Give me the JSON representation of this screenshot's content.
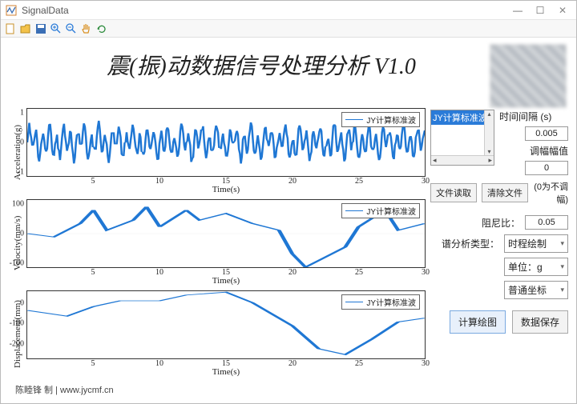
{
  "window": {
    "title": "SignalData"
  },
  "app": {
    "title": "震(振)动数据信号处理分析    V1.0"
  },
  "charts": {
    "xlabel": "Time(s)",
    "xticks": [
      "5",
      "10",
      "15",
      "20",
      "25",
      "30"
    ],
    "legend": "JY计算标准波",
    "accel": {
      "ylabel": "Acceleration(g)",
      "yticks": [
        "1",
        "0",
        "-1"
      ]
    },
    "vel": {
      "ylabel": "Velocity(mm/s)",
      "yticks": [
        "100",
        "0",
        "-100"
      ]
    },
    "disp": {
      "ylabel": "Displacement(mm)",
      "yticks": [
        "0",
        "-100",
        "-200"
      ]
    }
  },
  "side": {
    "list_selected": "JY计算标准波",
    "interval_label": "时间间隔 (s)",
    "interval_value": "0.005",
    "amp_label": "调幅幅值",
    "amp_value": "0",
    "amp_hint": "(0为不调幅)",
    "read_btn": "文件读取",
    "clear_btn": "清除文件",
    "damping_label": "阻尼比：",
    "damping_value": "0.05",
    "spectrum_label": "谱分析类型：",
    "spectrum_value": "时程绘制",
    "unit_label": "单位：g",
    "coord_value": "普通坐标",
    "plot_btn": "计算绘图",
    "save_btn": "数据保存"
  },
  "footer": "陈睦锋 制 | www.jycmf.cn",
  "chart_data": [
    {
      "type": "line",
      "title": "",
      "series_name": "JY计算标准波",
      "xlabel": "Time(s)",
      "ylabel": "Acceleration(g)",
      "xlim": [
        0,
        30
      ],
      "ylim": [
        -1,
        1
      ],
      "note": "dense oscillatory seismic acceleration waveform; values oscillate roughly between -0.9 and 0.9 over full 0–30s range"
    },
    {
      "type": "line",
      "title": "",
      "series_name": "JY计算标准波",
      "xlabel": "Time(s)",
      "ylabel": "Velocity(mm/s)",
      "xlim": [
        0,
        30
      ],
      "ylim": [
        -100,
        100
      ],
      "x": [
        0,
        2,
        4,
        5,
        6,
        8,
        9,
        10,
        12,
        13,
        15,
        17,
        19,
        20,
        21,
        22,
        24,
        25,
        27,
        28,
        30
      ],
      "y": [
        0,
        -10,
        30,
        70,
        10,
        40,
        80,
        20,
        70,
        40,
        60,
        30,
        10,
        -60,
        -100,
        -80,
        -40,
        20,
        70,
        10,
        30
      ]
    },
    {
      "type": "line",
      "title": "",
      "series_name": "JY计算标准波",
      "xlabel": "Time(s)",
      "ylabel": "Displacement(mm)",
      "xlim": [
        0,
        30
      ],
      "ylim": [
        -250,
        100
      ],
      "x": [
        0,
        3,
        5,
        7,
        10,
        12,
        15,
        17,
        20,
        22,
        24,
        26,
        28,
        30
      ],
      "y": [
        0,
        -30,
        20,
        50,
        50,
        80,
        95,
        40,
        -80,
        -200,
        -230,
        -150,
        -60,
        -40
      ]
    }
  ]
}
